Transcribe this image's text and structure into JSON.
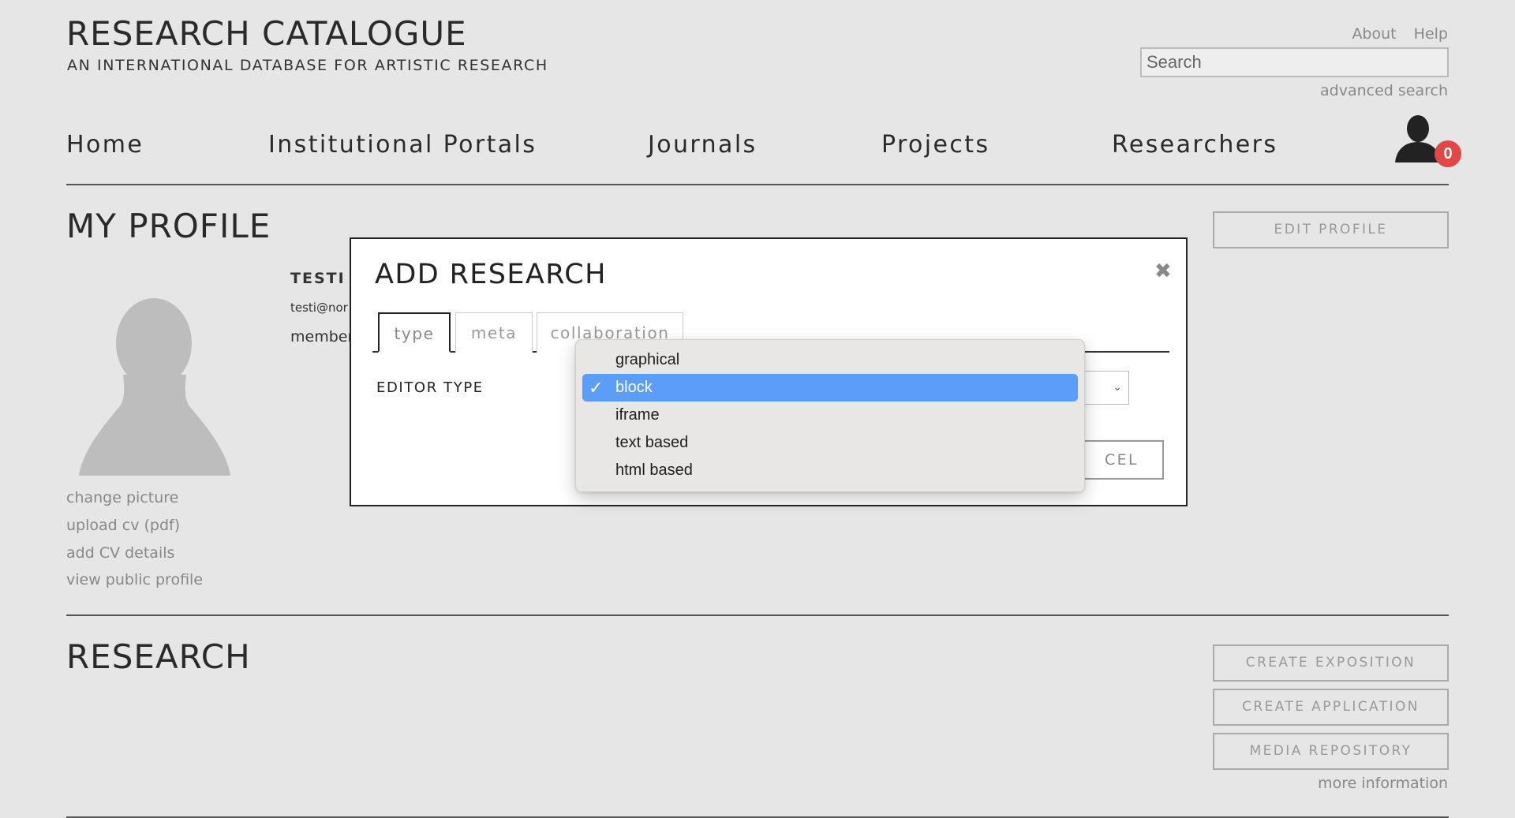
{
  "header": {
    "site_title": "RESEARCH CATALOGUE",
    "site_subtitle": "AN INTERNATIONAL DATABASE FOR ARTISTIC RESEARCH",
    "top_links": [
      "About",
      "Help"
    ],
    "search_placeholder": "Search",
    "advanced_search": "advanced search",
    "notification_count": "0"
  },
  "nav": {
    "items": [
      "Home",
      "Institutional Portals",
      "Journals",
      "Projects",
      "Researchers"
    ]
  },
  "profile": {
    "section_title": "MY PROFILE",
    "edit_button": "EDIT PROFILE",
    "name_partial": "TESTI U",
    "email_partial": "testi@nor",
    "member_partial": "member",
    "links": [
      "change picture",
      "upload cv (pdf)",
      "add CV details",
      "view public profile"
    ]
  },
  "research": {
    "section_title": "RESEARCH",
    "buttons": [
      "CREATE EXPOSITION",
      "CREATE APPLICATION",
      "MEDIA REPOSITORY"
    ],
    "more_info": "more information"
  },
  "modal": {
    "title": "ADD RESEARCH",
    "close_glyph": "✖",
    "tabs": [
      "type",
      "meta",
      "collaboration"
    ],
    "active_tab": "type",
    "editor_type_label": "EDITOR TYPE",
    "cancel_partial": "CEL",
    "select_arrow": "⌄"
  },
  "dropdown": {
    "options": [
      "graphical",
      "block",
      "iframe",
      "text based",
      "html based"
    ],
    "selected": "block",
    "check_glyph": "✓",
    "highlight_color": "#5b9df8"
  },
  "colors": {
    "background": "#e6e6e6",
    "badge": "#e04848",
    "accent_select": "#5b9df8"
  }
}
